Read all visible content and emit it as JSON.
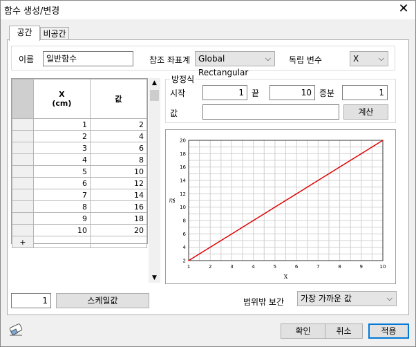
{
  "window": {
    "title": "함수 생성/변경",
    "close_glyph": "✕"
  },
  "tabs": [
    {
      "label": "공간"
    },
    {
      "label": "비공간"
    }
  ],
  "top_row": {
    "name_label": "이름",
    "name_value": "일반함수",
    "coord_label": "참조 좌표계",
    "coord_value": "Global Rectangular",
    "indep_label": "독립 변수",
    "indep_value": "X"
  },
  "grid": {
    "col_x_header": "X\n(cm)",
    "col_val_header": "값",
    "rows": [
      {
        "x": "1",
        "v": "2"
      },
      {
        "x": "2",
        "v": "4"
      },
      {
        "x": "3",
        "v": "6"
      },
      {
        "x": "4",
        "v": "8"
      },
      {
        "x": "5",
        "v": "10"
      },
      {
        "x": "6",
        "v": "12"
      },
      {
        "x": "7",
        "v": "14"
      },
      {
        "x": "8",
        "v": "16"
      },
      {
        "x": "9",
        "v": "18"
      },
      {
        "x": "10",
        "v": "20"
      }
    ],
    "add_row_glyph": "+"
  },
  "equation": {
    "group_label": "방정식",
    "start_label": "시작",
    "start_value": "1",
    "end_label": "끝",
    "end_value": "10",
    "step_label": "증분",
    "step_value": "1",
    "value_label": "값",
    "value_value": "",
    "calc_button": "계산"
  },
  "scale": {
    "value": "1",
    "button": "스케일값"
  },
  "extrapolation": {
    "label": "범위밖 보간",
    "value": "가장 가까운 값"
  },
  "footer": {
    "ok": "확인",
    "cancel": "취소",
    "apply": "적용"
  },
  "colors": {
    "line": "#e00000",
    "accent": "#0078d7",
    "grid": "#d0d0d0"
  },
  "icons": {
    "eraser": "eraser-icon",
    "chevron": "chevron-down-icon"
  },
  "chart_data": {
    "type": "line",
    "x": [
      1,
      2,
      3,
      4,
      5,
      6,
      7,
      8,
      9,
      10
    ],
    "series": [
      {
        "values": [
          2,
          4,
          6,
          8,
          10,
          12,
          14,
          16,
          18,
          20
        ]
      }
    ],
    "xlabel": "X",
    "ylabel": "값",
    "xlim": [
      1,
      10
    ],
    "ylim": [
      2,
      20
    ],
    "xticks": [
      "1",
      "2",
      "3",
      "4",
      "5",
      "6",
      "7",
      "8",
      "9",
      "10"
    ],
    "yticks": [
      "2",
      "4",
      "6",
      "8",
      "10",
      "12",
      "14",
      "16",
      "18",
      "20"
    ],
    "grid": true
  }
}
